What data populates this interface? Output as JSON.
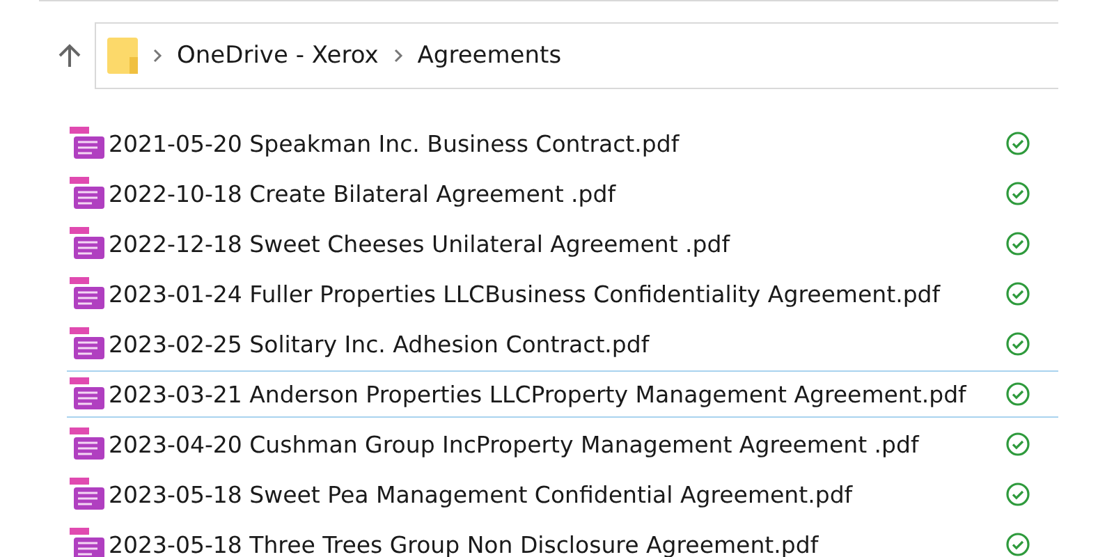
{
  "address_bar": {
    "path": [
      "OneDrive - Xerox",
      "Agreements"
    ]
  },
  "files": [
    {
      "name": "2021-05-20 Speakman Inc. Business Contract.pdf",
      "selected": false
    },
    {
      "name": "2022-10-18 Create Bilateral Agreement .pdf",
      "selected": false
    },
    {
      "name": "2022-12-18 Sweet Cheeses Unilateral Agreement .pdf",
      "selected": false
    },
    {
      "name": "2023-01-24 Fuller Properties LLCBusiness Confidentiality Agreement.pdf",
      "selected": false
    },
    {
      "name": "2023-02-25 Solitary Inc. Adhesion Contract.pdf",
      "selected": false
    },
    {
      "name": "2023-03-21 Anderson Properties LLCProperty Management Agreement.pdf",
      "selected": true
    },
    {
      "name": "2023-04-20 Cushman Group IncProperty Management Agreement .pdf",
      "selected": false
    },
    {
      "name": "2023-05-18 Sweet Pea Management Confidential Agreement.pdf",
      "selected": false
    },
    {
      "name": "2023-05-18 Three Trees Group Non Disclosure Agreement.pdf",
      "selected": false
    }
  ]
}
